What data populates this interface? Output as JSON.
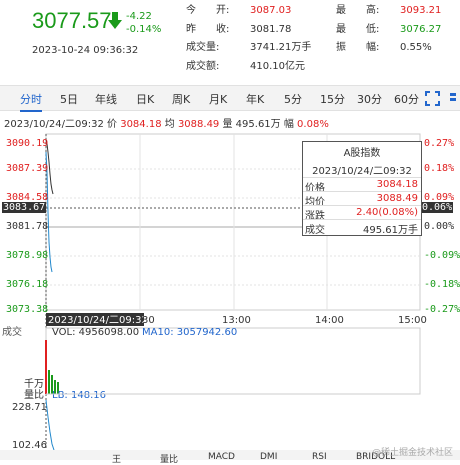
{
  "header": {
    "price": "3077.57",
    "change": "-4.22",
    "change_pct": "-0.14%",
    "datetime": "2023-10-24 09:36:32",
    "arrow_icon": "down-arrow-icon",
    "stats_left": [
      {
        "label": "今　　开:",
        "value": "3087.03",
        "color": "#e02020"
      },
      {
        "label": "昨　　收:",
        "value": "3081.78",
        "color": "#333333"
      },
      {
        "label": "成交量:",
        "value": "3741.21万手",
        "color": "#333333"
      },
      {
        "label": "成交额:",
        "value": "410.10亿元",
        "color": "#333333"
      }
    ],
    "stats_right": [
      {
        "label": "最　　高:",
        "value": "3093.21",
        "color": "#e02020"
      },
      {
        "label": "最　　低:",
        "value": "3076.27",
        "color": "#1a9a1a"
      },
      {
        "label": "振　　幅:",
        "value": "0.55%",
        "color": "#333333"
      }
    ]
  },
  "tabs": [
    "分时",
    "5日",
    "年线",
    "日K",
    "周K",
    "月K",
    "年K",
    "5分",
    "15分",
    "30分",
    "60分"
  ],
  "active_tab": "分时",
  "info_line": {
    "datetime": "2023/10/24/二09:32",
    "price_label": "价",
    "price": "3084.18",
    "avg_label": "均",
    "avg": "3088.49",
    "vol_label": "量",
    "vol": "495.61万",
    "pct_label": "幅",
    "pct": "0.08%"
  },
  "chart": {
    "y_left": [
      "3090.19",
      "3087.39",
      "3084.58",
      "3081.78",
      "3078.98",
      "3076.18",
      "3073.38"
    ],
    "y_right": [
      "0.27%",
      "0.18%",
      "0.09%",
      "0.00%",
      "-0.09%",
      "-0.18%",
      "-0.27%"
    ],
    "cursor_left": "3083.67",
    "cursor_right": "0.06%",
    "x_labels": [
      "30",
      "13:00",
      "14:00",
      "15:00"
    ],
    "x_cursor": "2023/10/24/二09:32",
    "vol_label": "成交",
    "vol_text": "VOL: 4956098.00",
    "ma10_text": "MA10: 3057942.60",
    "unit_label": "千万",
    "lb_label": "量比",
    "lb_text": "LB: 148.16",
    "lb_ticks": [
      "228.71",
      "102.46"
    ]
  },
  "tooltip": {
    "title": "A股指数",
    "time": "2023/10/24/二09:32",
    "rows": [
      {
        "k": "价格",
        "v": "3084.18",
        "color": "#e02020"
      },
      {
        "k": "均价",
        "v": "3088.49",
        "color": "#e02020"
      },
      {
        "k": "涨跌",
        "v": "2.40(0.08%)",
        "color": "#e02020"
      },
      {
        "k": "成交",
        "v": "495.61万手",
        "color": "#333333"
      }
    ]
  },
  "bottom_tabs": [
    "王",
    "量比",
    "MACD",
    "DMI",
    "RSI",
    "BRIDOLL"
  ],
  "watermark": "@稀土掘金技术社区"
}
